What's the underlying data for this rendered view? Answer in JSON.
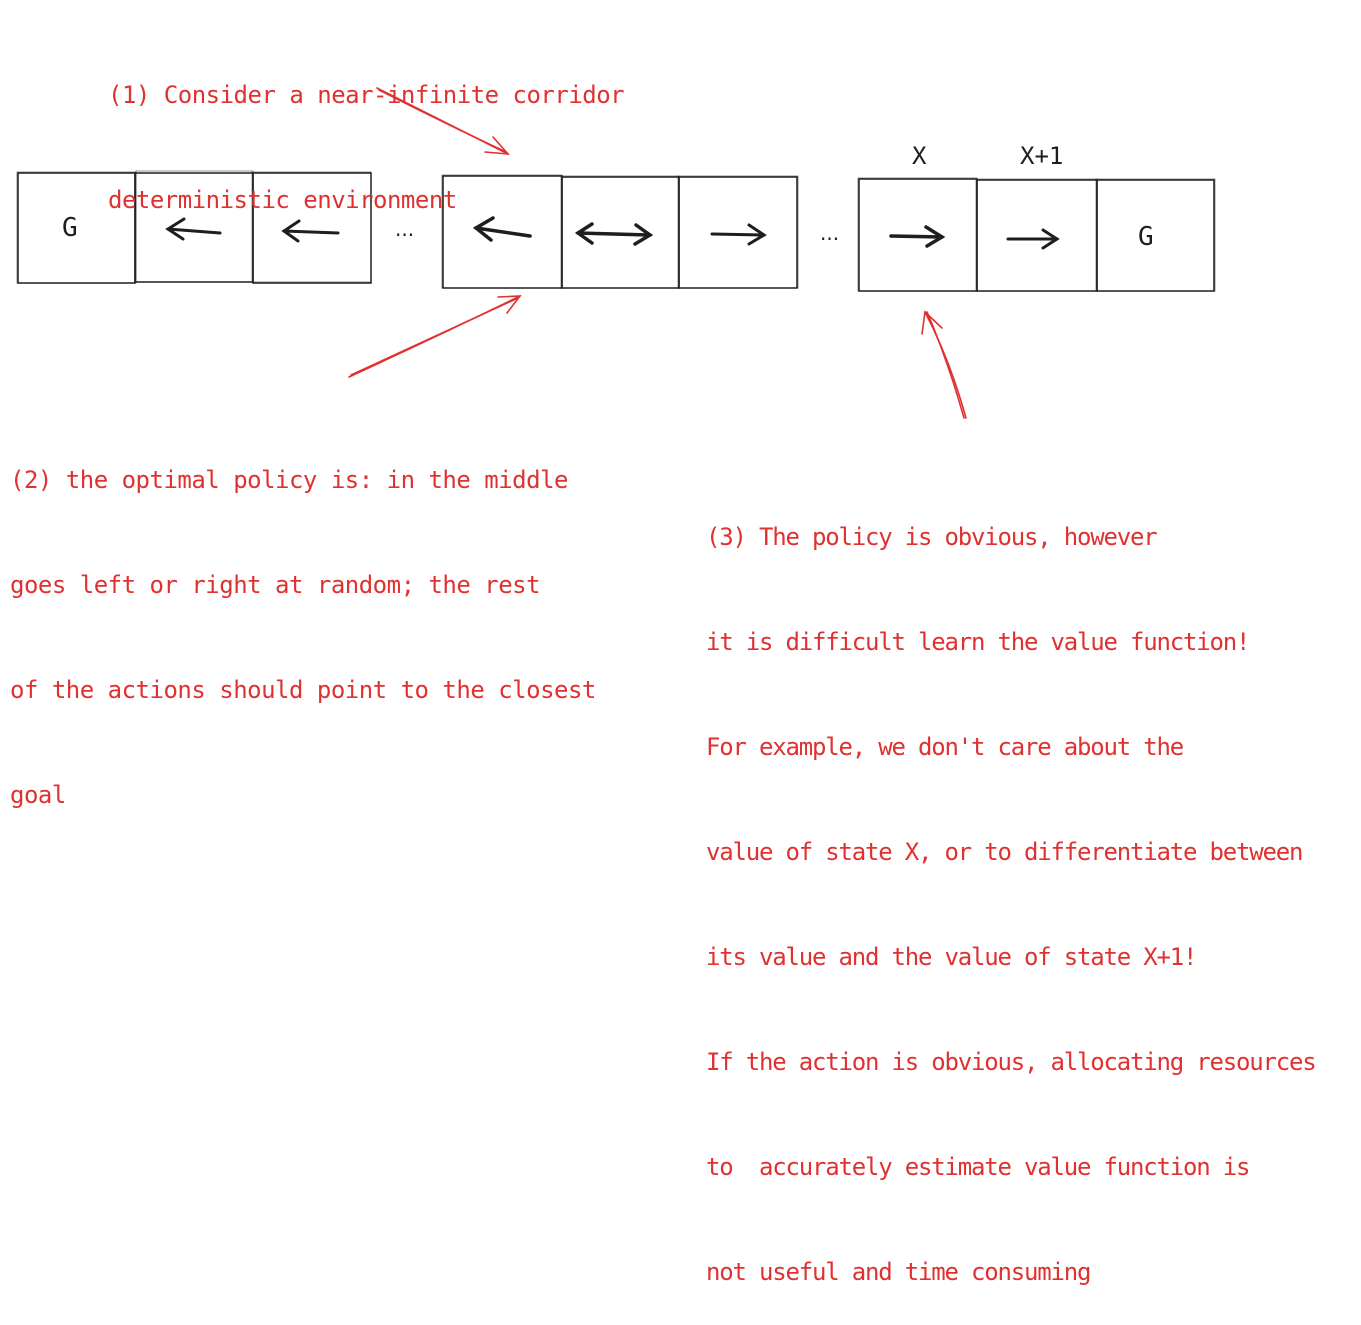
{
  "notes": {
    "note1": {
      "lines": [
        "(1) Consider a near-infinite corridor",
        "deterministic environment"
      ]
    },
    "note2": {
      "lines": [
        "(2) the optimal policy is: in the middle",
        "goes left or right at random; the rest",
        "of the actions should point to the closest",
        "goal"
      ]
    },
    "note3": {
      "lines": [
        "(3) The policy is obvious, however",
        "it is difficult learn the value function!",
        "For example, we don't care about the",
        "value of state X, or to differentiate between",
        "its value and the value of state X+1!",
        "If the action is obvious, allocating resources",
        "to  accurately estimate value function is",
        "not useful and time consuming"
      ]
    }
  },
  "corridor": {
    "groups": [
      {
        "cells": [
          {
            "content": "goal",
            "label": "G"
          },
          {
            "content": "arrow-left",
            "label": ""
          },
          {
            "content": "arrow-left",
            "label": ""
          }
        ]
      },
      {
        "cells": [
          {
            "content": "arrow-left",
            "label": ""
          },
          {
            "content": "arrow-both",
            "label": ""
          },
          {
            "content": "arrow-right",
            "label": ""
          }
        ]
      },
      {
        "cells": [
          {
            "content": "arrow-right",
            "label": ""
          },
          {
            "content": "arrow-right",
            "label": ""
          },
          {
            "content": "goal",
            "label": "G"
          }
        ]
      }
    ],
    "ellipsis": [
      "...",
      "..."
    ],
    "state_labels": [
      "X",
      "X+1"
    ]
  },
  "colors": {
    "annotation": "#e03131",
    "stroke": "#1e1e1e",
    "background": "#ffffff"
  }
}
